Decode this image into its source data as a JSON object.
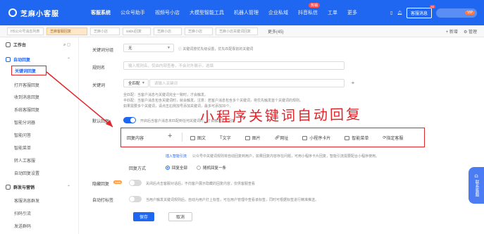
{
  "brand": {
    "name": "芝麻小客服"
  },
  "nav": {
    "items": [
      "客服系统",
      "公众号助手",
      "视频号小店",
      "大模型智能工具",
      "机器人管理",
      "企业私域",
      "抖音私信",
      "工单",
      "更多"
    ],
    "hot_badge": "热销"
  },
  "top_right": {
    "message_center": "客服消息",
    "badge": "99",
    "vip": "VIP"
  },
  "tabs": {
    "items": [
      "H5公众号消息列表",
      "芝麻客服回复",
      "芝麻小店",
      "wabu回复",
      "芝麻小店",
      "芝麻小店",
      "芝麻小店关键词回复"
    ],
    "more": "更多(45)",
    "add": "+ 新增",
    "manage": "管理"
  },
  "sidebar": {
    "workbench": "工作台",
    "auto_reply": "自动回复",
    "items": [
      "关键词回复",
      "打开客服回复",
      "收到消息回复",
      "系统客服回复",
      "智能分词器",
      "智能问答",
      "智能菜单",
      "转人工客服",
      "自动回复设置"
    ],
    "group_marketing": "群发与营销",
    "marketing_items": [
      "客服消息群发",
      "扫码引流",
      "发送群码"
    ]
  },
  "form": {
    "keyword_group_label": "关键词分组",
    "keyword_group_value": "无",
    "keyword_group_hint": "关键词按优先级设置，优先匹配靠前的关键词",
    "rule_name_label": "规则名",
    "rule_name_placeholder": "输入规则名，仅由内部查看，不会对外展示，选填",
    "keyword_label": "关键词",
    "match_value": "全匹配",
    "keyword_placeholder": "请输入关键词",
    "keyword_hints": [
      "全匹配：当客户消息与关键词完全一致时，才会触发。",
      "半匹配：当客户消息包含关键词时，就会触发。注意：若客户消息包含多个关键词，将优先触发首个关键词的规则。",
      "如果需要多个关键词，请点击右侧加号添加关键词，最多可添加30个。"
    ],
    "default_reply_label": "默认回复",
    "default_reply_hint": "开启后当客户消息未匹配到任何关键词时，才会触发默认回复",
    "reply_content_label": "回复内容",
    "reply_types": [
      "图文",
      "文字",
      "图片",
      "网址",
      "小程序卡片",
      "智能菜单",
      "指定客服"
    ],
    "insert_link": "插入智能引流",
    "insert_hint": "公众号中关键词规则将自动回复到用户，如果回复内容存在问题，可用小程序卡片回复，智能引流需要配合小程序使用。",
    "reply_method_label": "回复方式",
    "reply_all": "回复全部",
    "reply_random": "随机回复一条",
    "hide_label": "隐藏回复",
    "hide_badge": "new",
    "hide_hint": "关闭后点击客服对话后，不向客户展示隐藏的回复内容，仅供客服查看",
    "auto_tag_label": "自动打标签",
    "auto_tag_hint": "当用户触发关键词规则后，自动为用户打上标签，可在用户管理中查看该标签，同时可根据标签进行精准推送。",
    "save": "保存",
    "cancel": "取消"
  },
  "annotation": {
    "text": "小程序关键词自动回复"
  },
  "float": {
    "label": "联系客服"
  }
}
